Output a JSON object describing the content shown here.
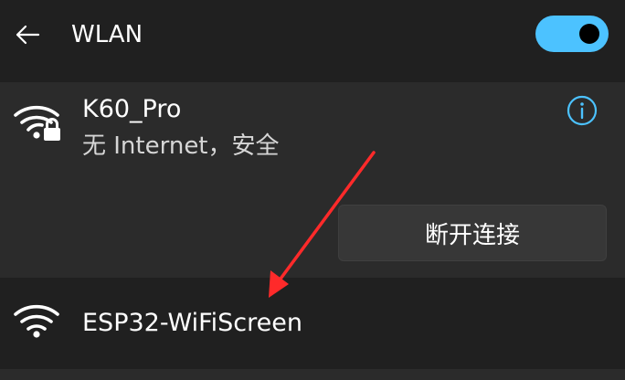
{
  "header": {
    "title": "WLAN",
    "back_icon": "back-arrow-icon",
    "toggle_state": "on"
  },
  "connected_network": {
    "name": "K60_Pro",
    "status": "无 Internet，安全",
    "icon": "wifi-secured-icon",
    "info_icon": "info-icon",
    "disconnect_label": "断开连接"
  },
  "available_networks": [
    {
      "name": "ESP32-WiFiScreen",
      "icon": "wifi-icon"
    }
  ],
  "colors": {
    "accent": "#4cc2ff",
    "annotation_arrow": "#ff2a2a"
  }
}
